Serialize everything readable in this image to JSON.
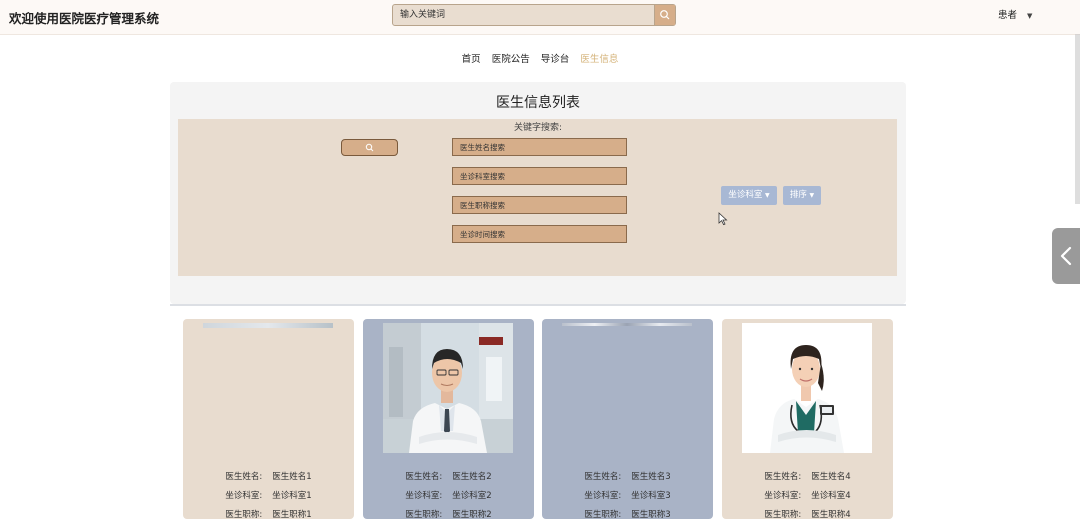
{
  "header": {
    "title": "欢迎使用医院医疗管理系统",
    "search_placeholder": "输入关键词",
    "user_label": "患者"
  },
  "nav": [
    {
      "label": "首页",
      "active": false
    },
    {
      "label": "医院公告",
      "active": false
    },
    {
      "label": "导诊台",
      "active": false
    },
    {
      "label": "医生信息",
      "active": true
    }
  ],
  "page": {
    "title": "医生信息列表",
    "keyword_label": "关键字搜索:",
    "fields": [
      {
        "placeholder": "医生姓名搜索"
      },
      {
        "placeholder": "坐诊科室搜索"
      },
      {
        "placeholder": "医生职称搜索"
      },
      {
        "placeholder": "坐诊时间搜索"
      }
    ],
    "dropdowns": [
      "坐诊科室",
      "排序"
    ]
  },
  "cards": [
    {
      "bg": "#e8dccf",
      "photo": "none",
      "name_label": "医生姓名:",
      "name": "医生姓名1",
      "dept_label": "坐诊科室:",
      "dept": "坐诊科室1",
      "title_label": "医生职称:",
      "title": "医生职称1"
    },
    {
      "bg": "#a9b3c6",
      "photo": "male-doctor",
      "name_label": "医生姓名:",
      "name": "医生姓名2",
      "dept_label": "坐诊科室:",
      "dept": "坐诊科室2",
      "title_label": "医生职称:",
      "title": "医生职称2"
    },
    {
      "bg": "#a9b3c6",
      "photo": "none",
      "name_label": "医生姓名:",
      "name": "医生姓名3",
      "dept_label": "坐诊科室:",
      "dept": "坐诊科室3",
      "title_label": "医生职称:",
      "title": "医生职称3"
    },
    {
      "bg": "#e8dccf",
      "photo": "female-doctor",
      "name_label": "医生姓名:",
      "name": "医生姓名4",
      "dept_label": "坐诊科室:",
      "dept": "坐诊科室4",
      "title_label": "医生职称:",
      "title": "医生职称4"
    }
  ],
  "colors": {
    "accent": "#d6ae8a",
    "nav_active": "#d4b37a",
    "dropdown": "#a8b8d4"
  }
}
